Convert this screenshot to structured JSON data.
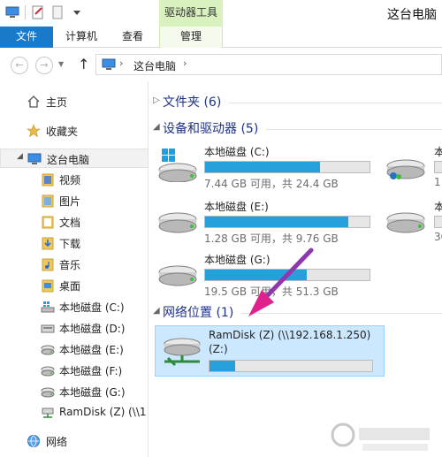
{
  "window": {
    "title": "这台电脑",
    "contextual_tab": "驱动器工具"
  },
  "ribbon": {
    "tabs": [
      {
        "label": "文件"
      },
      {
        "label": "计算机"
      },
      {
        "label": "查看"
      },
      {
        "label": "管理"
      }
    ]
  },
  "address": {
    "path_label": "这台电脑"
  },
  "sidebar": {
    "items": [
      {
        "label": "主页",
        "icon": "home-icon"
      },
      {
        "label": "收藏夹",
        "icon": "star-icon"
      },
      {
        "label": "这台电脑",
        "icon": "computer-icon",
        "selected": true
      },
      {
        "label": "视频",
        "icon": "folder-icon"
      },
      {
        "label": "图片",
        "icon": "folder-icon"
      },
      {
        "label": "文档",
        "icon": "folder-icon"
      },
      {
        "label": "下载",
        "icon": "download-folder-icon"
      },
      {
        "label": "音乐",
        "icon": "folder-icon"
      },
      {
        "label": "桌面",
        "icon": "folder-icon"
      },
      {
        "label": "本地磁盘 (C:)",
        "icon": "windows-drive-icon"
      },
      {
        "label": "本地磁盘 (D:)",
        "icon": "drive-icon"
      },
      {
        "label": "本地磁盘 (E:)",
        "icon": "drive-icon"
      },
      {
        "label": "本地磁盘 (F:)",
        "icon": "drive-icon"
      },
      {
        "label": "本地磁盘 (G:)",
        "icon": "drive-icon"
      },
      {
        "label": "RamDisk (Z) (\\\\1",
        "icon": "network-drive-icon"
      },
      {
        "label": "网络",
        "icon": "network-icon"
      }
    ]
  },
  "groups": {
    "folders": "文件夹 (6)",
    "devices": "设备和驱动器 (5)",
    "network": "网络位置 (1)"
  },
  "drives": [
    {
      "name": "本地磁盘 (C:)",
      "info": "7.44 GB 可用，共 24.4 GB",
      "used_fraction": 0.7,
      "icon": "windows-drive-icon"
    },
    {
      "name": "本地磁盘 (E:)",
      "info": "1.28 GB 可用，共 9.76 GB",
      "used_fraction": 0.87,
      "icon": "drive-icon"
    },
    {
      "name": "本地磁盘 (G:)",
      "info": "19.5 GB 可用，共 51.3 GB",
      "used_fraction": 0.62,
      "icon": "drive-icon"
    }
  ],
  "partial_drives": [
    {
      "name": "本",
      "info": "1",
      "icon": "user-drive-icon"
    },
    {
      "name": "本",
      "info": "30",
      "icon": "drive-icon"
    }
  ],
  "network_drive": {
    "name": "RamDisk (Z) (\\\\192.168.1.250)",
    "name2": "(Z:)",
    "used_fraction": 0.16,
    "icon": "network-drive-icon"
  },
  "colors": {
    "accent": "#1979ca",
    "bar_fill": "#26a0da",
    "contextual_tab": "#d9f0bf",
    "selection": "#cce8ff",
    "arrow": "#e0208c"
  }
}
